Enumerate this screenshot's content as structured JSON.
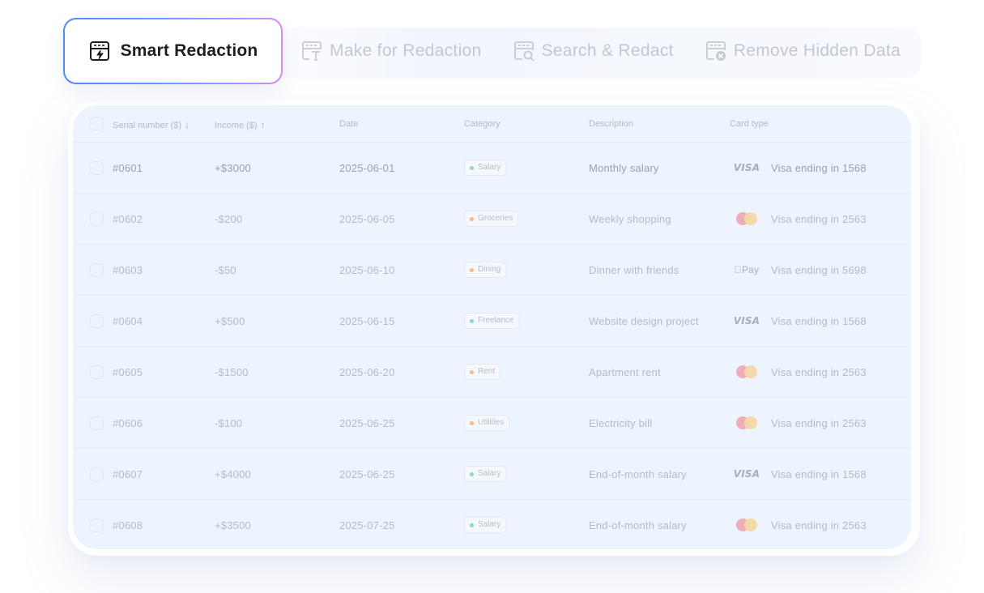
{
  "tabs": [
    {
      "label": "Smart Redaction",
      "icon": "smart-redaction-icon",
      "active": true
    },
    {
      "label": "Make for Redaction",
      "icon": "mark-redaction-icon",
      "active": false
    },
    {
      "label": "Search & Redact",
      "icon": "search-redact-icon",
      "active": false
    },
    {
      "label": "Remove Hidden Data",
      "icon": "remove-hidden-data-icon",
      "active": false
    }
  ],
  "table": {
    "headers": {
      "serial": "Serial number ($)",
      "income": "Income ($)",
      "date": "Date",
      "category": "Category",
      "description": "Description",
      "card_type": "Card type"
    },
    "sort": {
      "serial": "↓",
      "income": "↑"
    },
    "rows": [
      {
        "serial": "#0601",
        "income": "+$3000",
        "date": "2025-06-01",
        "category": "Salary",
        "category_color": "#8fd7c5",
        "description": "Monthly salary",
        "card_brand": "VISA",
        "card": "Visa ending in 1568"
      },
      {
        "serial": "#0602",
        "income": "-$200",
        "date": "2025-06-05",
        "category": "Groceries",
        "category_color": "#f4b88a",
        "description": "Weekly shopping",
        "card_brand": "mastercard",
        "card": "Visa ending in 2563"
      },
      {
        "serial": "#0603",
        "income": "-$50",
        "date": "2025-06-10",
        "category": "Dining",
        "category_color": "#f4b88a",
        "description": "Dinner with friends",
        "card_brand": "Pay",
        "card": "Visa ending in 5698"
      },
      {
        "serial": "#0604",
        "income": "+$500",
        "date": "2025-06-15",
        "category": "Freelance",
        "category_color": "#8fd7c5",
        "description": "Website design project",
        "card_brand": "VISA",
        "card": "Visa ending in 1568"
      },
      {
        "serial": "#0605",
        "income": "-$1500",
        "date": "2025-06-20",
        "category": "Rent",
        "category_color": "#f4b88a",
        "description": "Apartment rent",
        "card_brand": "mastercard",
        "card": "Visa ending in 2563"
      },
      {
        "serial": "#0606",
        "income": "-$100",
        "date": "2025-06-25",
        "category": "Utilities",
        "category_color": "#f4b88a",
        "description": "Electricity bill",
        "card_brand": "mastercard",
        "card": "Visa ending in 2563"
      },
      {
        "serial": "#0607",
        "income": "+$4000",
        "date": "2025-06-25",
        "category": "Salary",
        "category_color": "#8fd7c5",
        "description": "End-of-month salary",
        "card_brand": "VISA",
        "card": "Visa ending in 1568"
      },
      {
        "serial": "#0608",
        "income": "+$3500",
        "date": "2025-07-25",
        "category": "Salary",
        "category_color": "#8fd7c5",
        "description": "End-of-month salary",
        "card_brand": "mastercard",
        "card": "Visa ending in 2563"
      }
    ]
  }
}
